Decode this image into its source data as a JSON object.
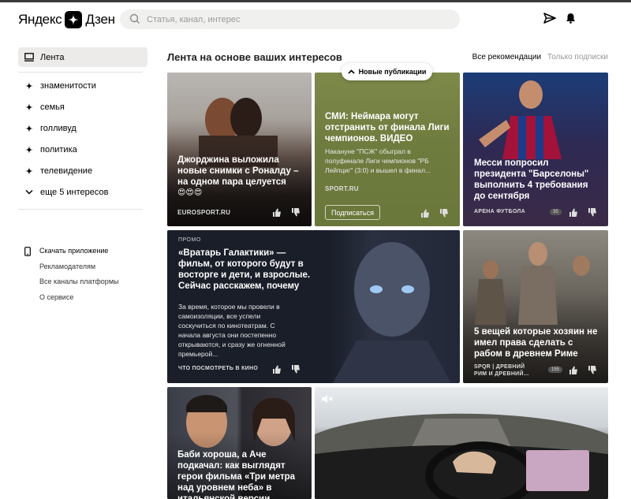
{
  "header": {
    "logo_left": "Яндекс",
    "logo_right": "Дзен",
    "search_placeholder": "Статья, канал, интерес"
  },
  "sidebar": {
    "items": [
      {
        "label": "Лента",
        "icon": "monitor-icon"
      },
      {
        "label": "знаменитости",
        "icon": "sparkle-icon"
      },
      {
        "label": "семья",
        "icon": "sparkle-icon"
      },
      {
        "label": "голливуд",
        "icon": "sparkle-icon"
      },
      {
        "label": "политика",
        "icon": "sparkle-icon"
      },
      {
        "label": "телевидение",
        "icon": "sparkle-icon"
      },
      {
        "label": "еще 5 интересов",
        "icon": "chevron-down-icon"
      }
    ],
    "links": [
      "Скачать приложение",
      "Рекламодателям",
      "Все каналы платформы",
      "О сервисе"
    ]
  },
  "feed": {
    "title": "Лента на основе ваших интересов",
    "tab_all": "Все рекомендации",
    "tab_subs": "Только подписки",
    "new_pubs": "Новые публикации"
  },
  "cards": [
    {
      "title": "Джорджина выложила новые снимки с Роналду – на одном пара целуется",
      "emoji": "😍😍😍",
      "source": "EUROSPORT.RU"
    },
    {
      "title": "СМИ: Неймара могут отстранить от финала Лиги чемпионов. ВИДЕО",
      "text": "Накануне \"ПСЖ\" обыграл в полуфинале Лиги чемпионов \"РБ Лейпциг\" (3:0) и вышел в финал...",
      "source": "SPORT.RU",
      "button": "Подписаться"
    },
    {
      "title": "Месси попросил президента \"Барселоны\" выполнить 4 требования до сентября",
      "source": "АРЕНА ФУТБОЛА",
      "badge": "35"
    },
    {
      "promo": "ПРОМО",
      "title": "«Вратарь Галактики» — фильм, от которого будут в восторге и дети, и взрослые. Сейчас расскажем, почему",
      "text": "За время, которое мы провели в самоизоляции, все успели соскучиться по кинотеатрам. С начала августа они постепенно открываются, и сразу же огненной премьерой...",
      "source": "ЧТО ПОСМОТРЕТЬ В КИНО"
    },
    {
      "title": "5 вещей которые хозяин не имел права сделать с рабом в древнем Риме",
      "source": "SPQR | ДРЕВНИЙ РИМ И ДРЕВНИЙ...",
      "badge": "155"
    },
    {
      "title": "Баби хороша, а Аче подкачал: как выглядят герои фильма «Три метра над уровнем неба» в итальянской версии"
    }
  ],
  "colors": {
    "accent": "#000000",
    "sidebar_active": "#ecebe9",
    "search_bg": "#f0f0ef"
  }
}
